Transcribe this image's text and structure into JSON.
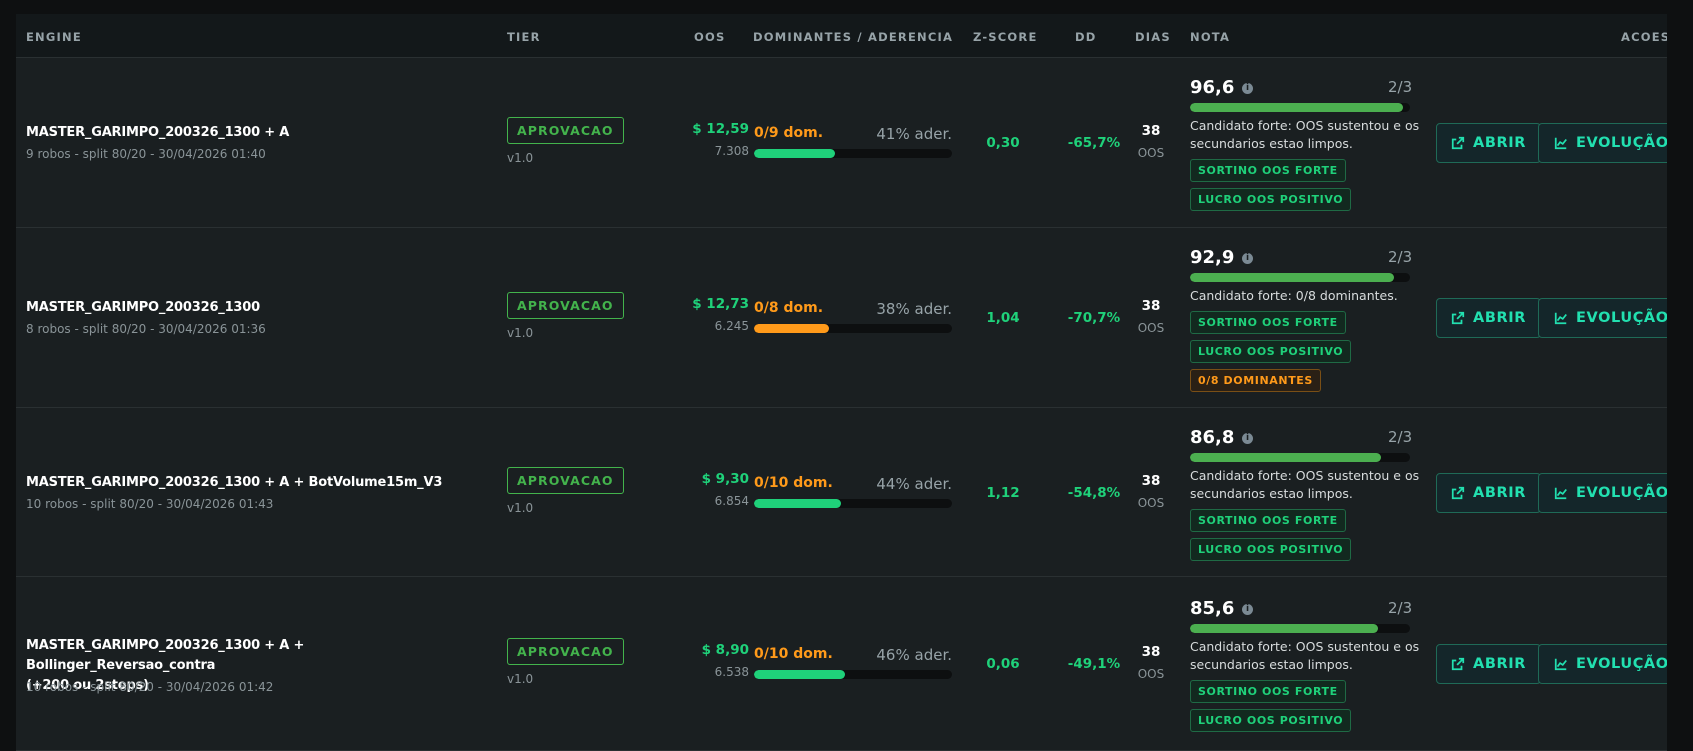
{
  "header": {
    "engine": "ENGINE",
    "tier": "TIER",
    "oos": "OOS",
    "dominantes": "DOMINANTES / ADERENCIA",
    "zscore": "Z-SCORE",
    "dd": "DD",
    "dias": "DIAS",
    "nota": "NOTA",
    "acoes": "ACOES"
  },
  "colors": {
    "green": "#1fd17a",
    "orange": "#ff9a1a",
    "teal_button": "#22e0b0",
    "nota_bar": "#4caf50",
    "tier_green": "#43b34c"
  },
  "rows": [
    {
      "engine": "MASTER_GARIMPO_200326_1300 + A",
      "engine_cont": "",
      "sub": "9 robos - split 80/20 - 30/04/2026 01:40",
      "tier": "APROVACAO",
      "version": "v1.0",
      "oos_value": "$ 12,59",
      "oos_sub": "7.308",
      "dom_label": "0/9 dom.",
      "ader": "41% ader.",
      "ader_pct": 41,
      "bar_color": "green",
      "zscore": "0,30",
      "dd": "-65,7%",
      "dias": "38",
      "dias_sub": "OOS",
      "score": "96,6",
      "score_pct": 96.6,
      "frac": "2/3",
      "note": "Candidato forte: OOS sustentou e os secundarios estao limpos.",
      "badges": [
        {
          "text": "SORTINO OOS FORTE",
          "color": "green"
        },
        {
          "text": "LUCRO OOS POSITIVO",
          "color": "green"
        }
      ],
      "btn_open": "ABRIR",
      "btn_evo": "EVOLUÇÃO"
    },
    {
      "engine": "MASTER_GARIMPO_200326_1300",
      "engine_cont": "",
      "sub": "8 robos - split 80/20 - 30/04/2026 01:36",
      "tier": "APROVACAO",
      "version": "v1.0",
      "oos_value": "$ 12,73",
      "oos_sub": "6.245",
      "dom_label": "0/8 dom.",
      "ader": "38% ader.",
      "ader_pct": 38,
      "bar_color": "orange",
      "zscore": "1,04",
      "dd": "-70,7%",
      "dias": "38",
      "dias_sub": "OOS",
      "score": "92,9",
      "score_pct": 92.9,
      "frac": "2/3",
      "note": "Candidato forte: 0/8 dominantes.",
      "badges": [
        {
          "text": "SORTINO OOS FORTE",
          "color": "green"
        },
        {
          "text": "LUCRO OOS POSITIVO",
          "color": "green"
        },
        {
          "text": "0/8 DOMINANTES",
          "color": "orange"
        }
      ],
      "btn_open": "ABRIR",
      "btn_evo": "EVOLUÇÃO"
    },
    {
      "engine": "MASTER_GARIMPO_200326_1300 + A + BotVolume15m_V3",
      "engine_cont": "",
      "sub": "10 robos - split 80/20 - 30/04/2026 01:43",
      "tier": "APROVACAO",
      "version": "v1.0",
      "oos_value": "$ 9,30",
      "oos_sub": "6.854",
      "dom_label": "0/10 dom.",
      "ader": "44% ader.",
      "ader_pct": 44,
      "bar_color": "green",
      "zscore": "1,12",
      "dd": "-54,8%",
      "dias": "38",
      "dias_sub": "OOS",
      "score": "86,8",
      "score_pct": 86.8,
      "frac": "2/3",
      "note": "Candidato forte: OOS sustentou e os secundarios estao limpos.",
      "badges": [
        {
          "text": "SORTINO OOS FORTE",
          "color": "green"
        },
        {
          "text": "LUCRO OOS POSITIVO",
          "color": "green"
        }
      ],
      "btn_open": "ABRIR",
      "btn_evo": "EVOLUÇÃO"
    },
    {
      "engine": "MASTER_GARIMPO_200326_1300 + A + Bollinger_Reversao_contra",
      "engine_cont": "(+200 ou 2stops)",
      "sub": "10 robos - split 80/20 - 30/04/2026 01:42",
      "tier": "APROVACAO",
      "version": "v1.0",
      "oos_value": "$ 8,90",
      "oos_sub": "6.538",
      "dom_label": "0/10 dom.",
      "ader": "46% ader.",
      "ader_pct": 46,
      "bar_color": "green",
      "zscore": "0,06",
      "dd": "-49,1%",
      "dias": "38",
      "dias_sub": "OOS",
      "score": "85,6",
      "score_pct": 85.6,
      "frac": "2/3",
      "note": "Candidato forte: OOS sustentou e os secundarios estao limpos.",
      "badges": [
        {
          "text": "SORTINO OOS FORTE",
          "color": "green"
        },
        {
          "text": "LUCRO OOS POSITIVO",
          "color": "green"
        }
      ],
      "btn_open": "ABRIR",
      "btn_evo": "EVOLUÇÃO"
    }
  ]
}
